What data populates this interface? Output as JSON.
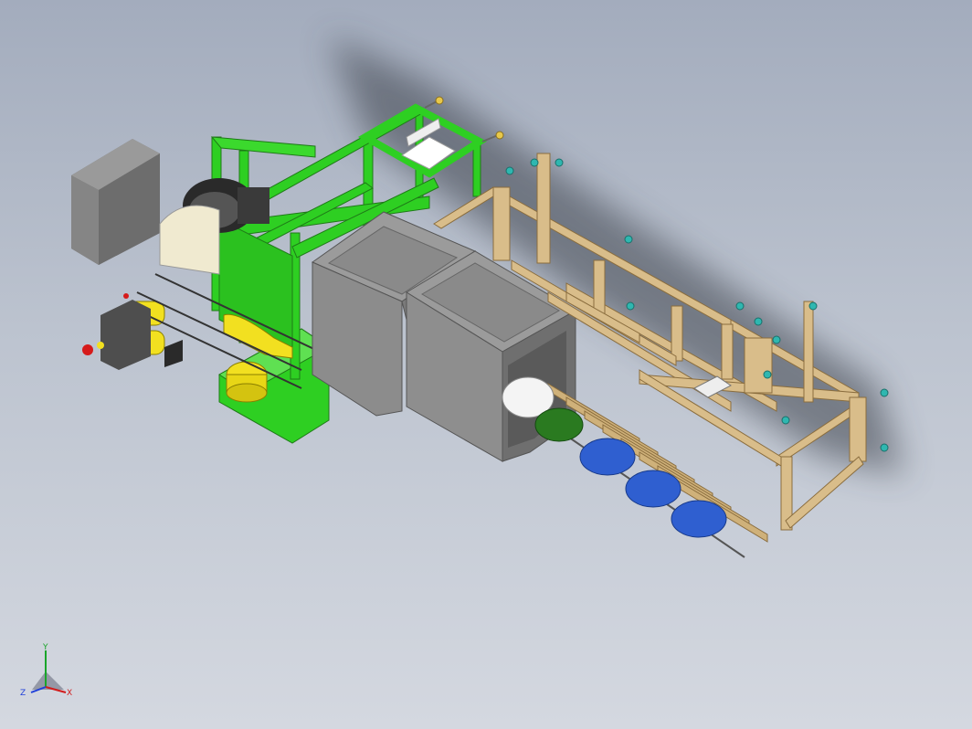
{
  "viewport": {
    "background_top": "#a3acbd",
    "background_bottom": "#d4d8e0"
  },
  "triad": {
    "x_label": "X",
    "y_label": "Y",
    "z_label": "Z",
    "x_color": "#d11c1c",
    "y_color": "#1aa52a",
    "z_color": "#1f3fd9"
  },
  "model": {
    "frame_color": "#2ecf22",
    "wood_color": "#d9bd8a",
    "cabinet_color": "#8c8c8c",
    "control_box_color": "#7a7a7a",
    "coil_blue": "#2f5fd0",
    "coil_yellow": "#f2e020",
    "bolt_teal": "#2fb7b0"
  }
}
